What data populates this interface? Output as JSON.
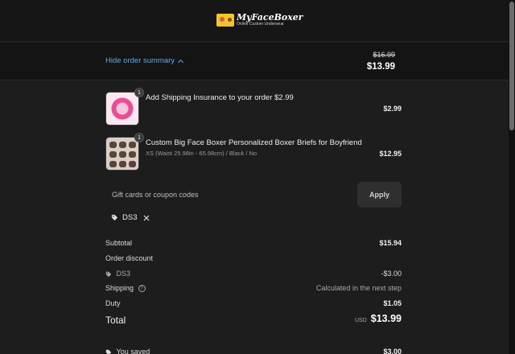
{
  "header": {
    "logo_text": "MyFaceBoxer",
    "logo_tagline": "Online Custom Underwear"
  },
  "summary": {
    "toggle_label": "Hide order summary",
    "original_total": "$16.99",
    "total": "$13.99"
  },
  "items": [
    {
      "title": "Add Shipping Insurance to your order $2.99",
      "variant": "",
      "price": "$2.99",
      "quantity": "1"
    },
    {
      "title": "Custom Big Face Boxer Personalized Boxer Briefs for Boyfriend",
      "variant": "XS (Waist 25.98in - 65.98cm) / Black / No",
      "price": "$12.95",
      "quantity": "1"
    }
  ],
  "coupon": {
    "placeholder": "Gift cards or coupon codes",
    "apply_label": "Apply",
    "applied_code": "DS3"
  },
  "totals": {
    "subtotal_label": "Subtotal",
    "subtotal": "$15.94",
    "discount_label": "Order discount",
    "discount_code": "DS3",
    "discount": "-$3.00",
    "shipping_label": "Shipping",
    "shipping": "Calculated in the next step",
    "duty_label": "Duty",
    "duty": "$1.05",
    "total_label": "Total",
    "currency": "USD",
    "total": "$13.99",
    "saved_label": "You saved",
    "saved": "$3.00"
  },
  "colors": {
    "background": "#1d1d1d",
    "header": "#161616",
    "link": "#6aa7e6"
  }
}
